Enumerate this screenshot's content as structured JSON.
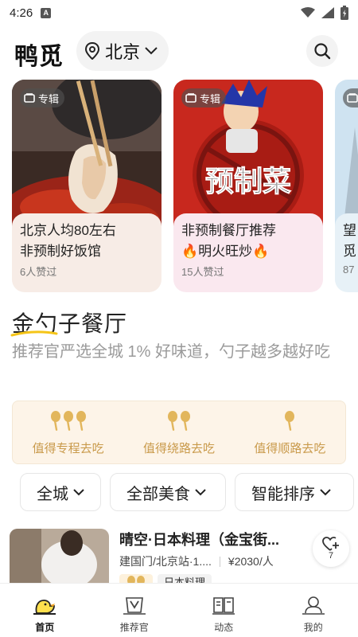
{
  "status": {
    "time": "4:26",
    "badge": "A"
  },
  "header": {
    "logo": "鸭觅",
    "city": "北京"
  },
  "cards": [
    {
      "tag": "专辑",
      "line1": "北京人均80左右",
      "line2": "非预制好饭馆",
      "likes": "6人赞过",
      "bg": "#f7ece6"
    },
    {
      "tag": "专辑",
      "line1": "非预制餐厅推荐",
      "line2": "🔥明火旺炒🔥",
      "likes": "15人赞过",
      "bg": "#fae8ef",
      "overlay_text": "预制菜"
    },
    {
      "tag": "专辑",
      "line1": "望",
      "line2": "觅",
      "likes": "87",
      "bg": "#e7f1f7"
    }
  ],
  "section": {
    "title": "金勺子餐厅",
    "subtitle": "推荐官严选全城 1% 好味道，勺子越多越好吃"
  },
  "spoons": [
    {
      "count": 3,
      "label": "值得专程去吃"
    },
    {
      "count": 2,
      "label": "值得绕路去吃"
    },
    {
      "count": 1,
      "label": "值得顺路去吃"
    }
  ],
  "filters": [
    {
      "label": "全城"
    },
    {
      "label": "全部美食"
    },
    {
      "label": "智能排序"
    }
  ],
  "restaurant": {
    "name": "晴空·日本料理（金宝街...",
    "location": "建国门/北京站·1....",
    "price": "¥2030/人",
    "category": "日本料理",
    "fav_count": "7"
  },
  "nav": [
    {
      "label": "首页",
      "icon": "duck-home-icon",
      "active": true
    },
    {
      "label": "推荐官",
      "icon": "recommender-icon",
      "active": false
    },
    {
      "label": "动态",
      "icon": "book-feed-icon",
      "active": false
    },
    {
      "label": "我的",
      "icon": "profile-icon",
      "active": false
    }
  ],
  "colors": {
    "accent": "#f5c518",
    "spoon": "#e2b65c",
    "spoon_text": "#c99a4b"
  }
}
